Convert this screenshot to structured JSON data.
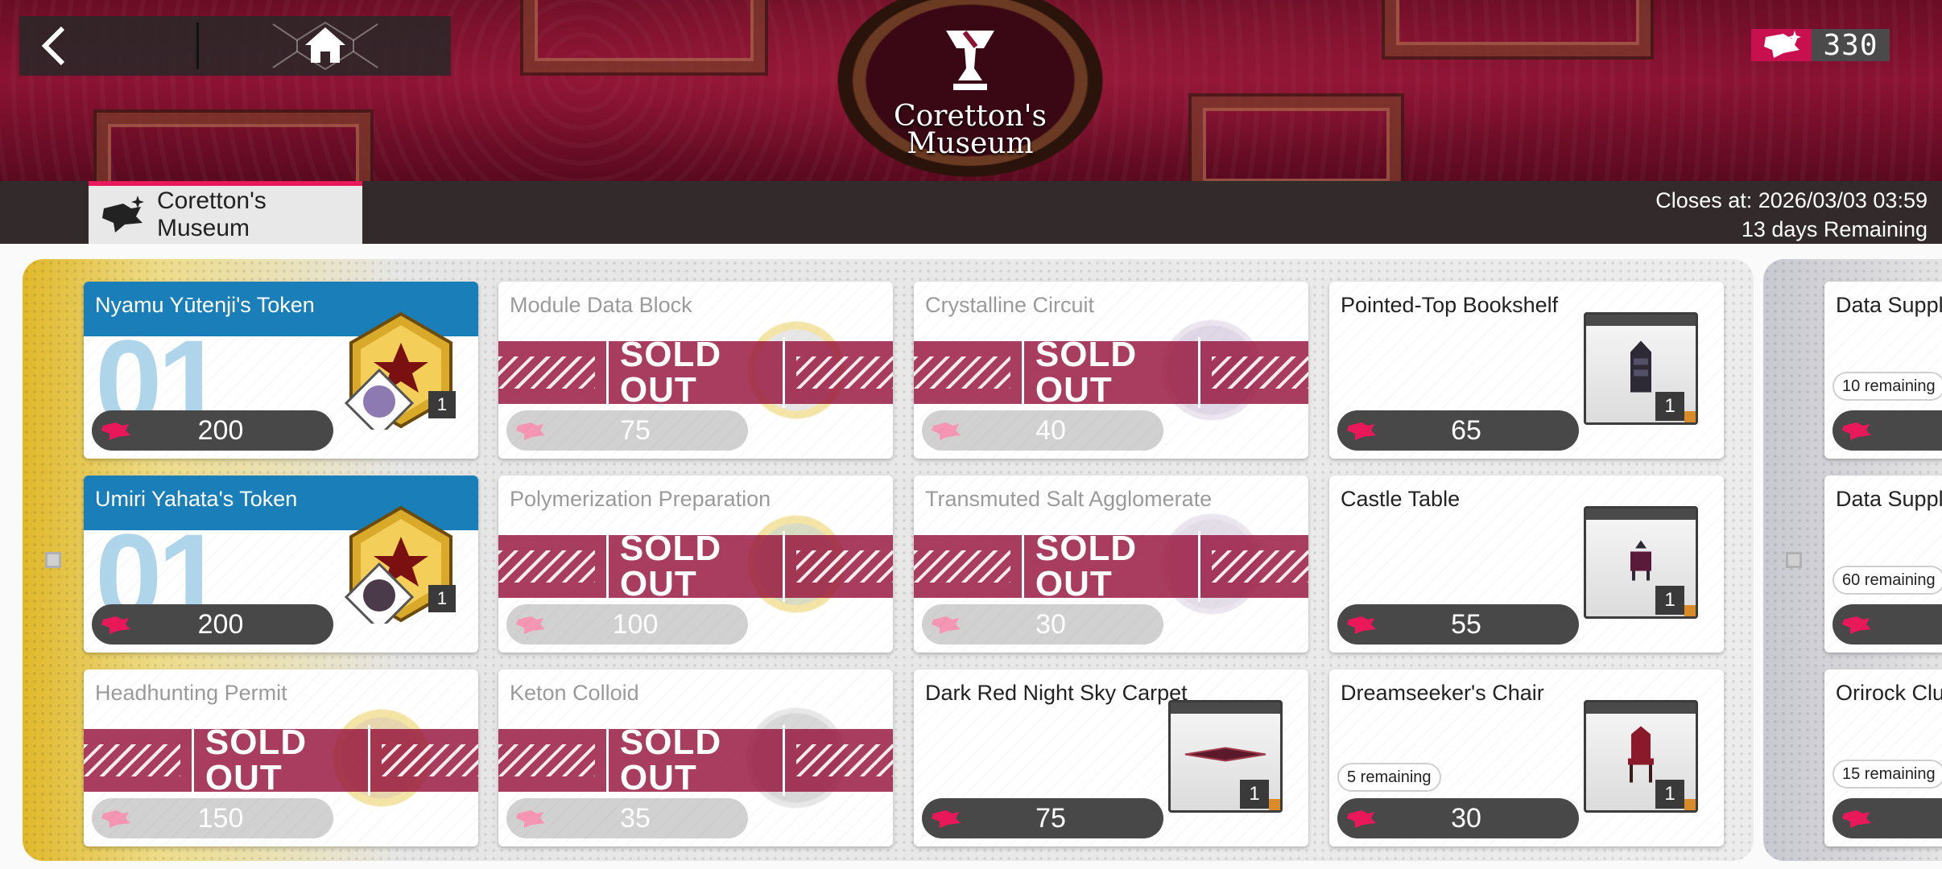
{
  "header": {
    "emblem_title_line1": "Coretton's",
    "emblem_title_line2": "Museum",
    "currency_value": "330"
  },
  "tab": {
    "label": "Coretton's Museum"
  },
  "schedule": {
    "closes_at": "Closes at: 2026/03/03 03:59",
    "remaining": "13 days Remaining"
  },
  "colors": {
    "accent": "#e8185a",
    "featured_header": "#1a7fb8",
    "soldout_band": "#96123c"
  },
  "items": [
    {
      "title": "Nyamu Yūtenji's Token",
      "price": "200",
      "big_number": "01",
      "qty": "1",
      "status": "featured"
    },
    {
      "title": "Module Data Block",
      "price": "75",
      "status": "SOLD OUT"
    },
    {
      "title": "Crystalline Circuit",
      "price": "40",
      "status": "SOLD OUT"
    },
    {
      "title": "Pointed-Top Bookshelf",
      "price": "65",
      "qty": "1"
    },
    {
      "title": "Umiri Yahata's Token",
      "price": "200",
      "big_number": "01",
      "qty": "1",
      "status": "featured"
    },
    {
      "title": "Polymerization Preparation",
      "price": "100",
      "status": "SOLD OUT"
    },
    {
      "title": "Transmuted Salt Agglomerate",
      "price": "30",
      "status": "SOLD OUT"
    },
    {
      "title": "Castle Table",
      "price": "55",
      "qty": "1"
    },
    {
      "title": "Headhunting Permit",
      "price": "150",
      "status": "SOLD OUT"
    },
    {
      "title": "Keton Colloid",
      "price": "35",
      "status": "SOLD OUT"
    },
    {
      "title": "Dark Red Night Sky Carpet",
      "price": "75",
      "qty": "1"
    },
    {
      "title": "Dreamseeker's Chair",
      "price": "30",
      "qty": "1",
      "remaining": "5 remaining"
    }
  ],
  "side_items": [
    {
      "title": "Data Suppler",
      "remaining": "10 remaining"
    },
    {
      "title": "Data Supple",
      "remaining": "60 remaining"
    },
    {
      "title": "Orirock Clus",
      "remaining": "15 remaining"
    }
  ],
  "sold_out_label": "SOLD OUT"
}
